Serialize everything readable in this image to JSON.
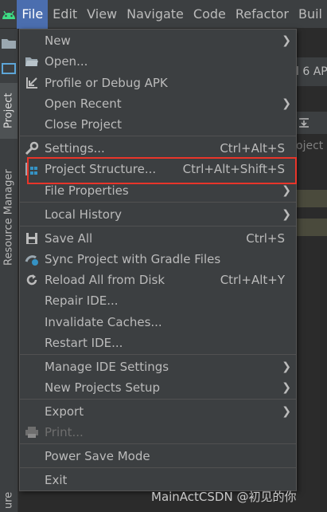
{
  "menubar": {
    "items": [
      {
        "label": "File"
      },
      {
        "label": "Edit"
      },
      {
        "label": "View"
      },
      {
        "label": "Navigate"
      },
      {
        "label": "Code"
      },
      {
        "label": "Refactor"
      },
      {
        "label": "Buil"
      }
    ]
  },
  "left_strip": {
    "project_label": "Project",
    "resource_manager_label": "Resource Manager",
    "bottom_label": "ure"
  },
  "background": {
    "tab_text": "l 6 AP",
    "project_text": "oject"
  },
  "file_menu": {
    "new": "New",
    "open": "Open...",
    "profile": "Profile or Debug APK",
    "open_recent": "Open Recent",
    "close_project": "Close Project",
    "settings": "Settings...",
    "settings_shortcut": "Ctrl+Alt+S",
    "project_structure": "Project Structure...",
    "project_structure_shortcut": "Ctrl+Alt+Shift+S",
    "file_properties": "File Properties",
    "local_history": "Local History",
    "save_all": "Save All",
    "save_all_shortcut": "Ctrl+S",
    "sync_gradle": "Sync Project with Gradle Files",
    "reload": "Reload All from Disk",
    "reload_shortcut": "Ctrl+Alt+Y",
    "repair": "Repair IDE...",
    "invalidate": "Invalidate Caches...",
    "restart": "Restart IDE...",
    "manage_settings": "Manage IDE Settings",
    "new_projects_setup": "New Projects Setup",
    "export": "Export",
    "print": "Print...",
    "power_save": "Power Save Mode",
    "exit": "Exit"
  },
  "watermark": "MainActCSDN @初见的你",
  "colors": {
    "menu_bg": "#3c3f41",
    "selected": "#4b6eaf",
    "highlight_box": "#e8352a"
  }
}
